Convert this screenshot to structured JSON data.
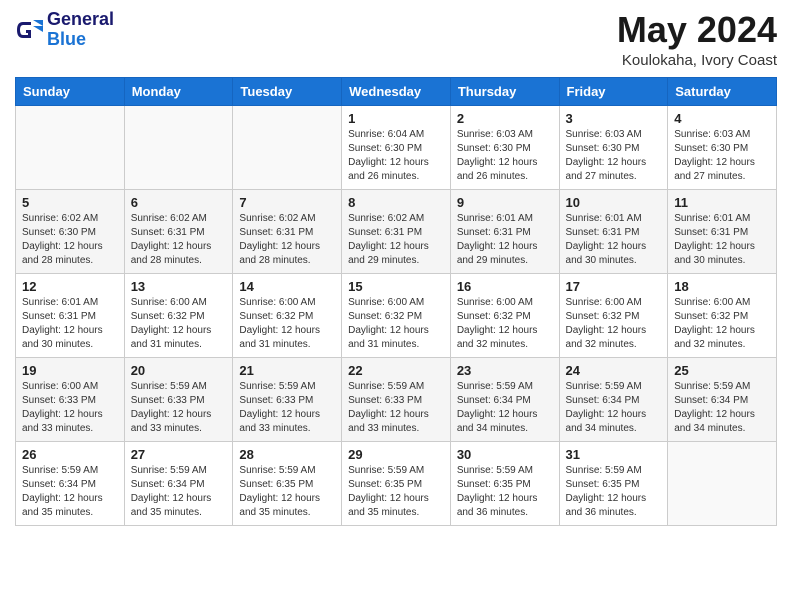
{
  "header": {
    "logo_line1": "General",
    "logo_line2": "Blue",
    "title": "May 2024",
    "location": "Koulokaha, Ivory Coast"
  },
  "weekdays": [
    "Sunday",
    "Monday",
    "Tuesday",
    "Wednesday",
    "Thursday",
    "Friday",
    "Saturday"
  ],
  "weeks": [
    [
      {
        "day": "",
        "info": ""
      },
      {
        "day": "",
        "info": ""
      },
      {
        "day": "",
        "info": ""
      },
      {
        "day": "1",
        "info": "Sunrise: 6:04 AM\nSunset: 6:30 PM\nDaylight: 12 hours\nand 26 minutes."
      },
      {
        "day": "2",
        "info": "Sunrise: 6:03 AM\nSunset: 6:30 PM\nDaylight: 12 hours\nand 26 minutes."
      },
      {
        "day": "3",
        "info": "Sunrise: 6:03 AM\nSunset: 6:30 PM\nDaylight: 12 hours\nand 27 minutes."
      },
      {
        "day": "4",
        "info": "Sunrise: 6:03 AM\nSunset: 6:30 PM\nDaylight: 12 hours\nand 27 minutes."
      }
    ],
    [
      {
        "day": "5",
        "info": "Sunrise: 6:02 AM\nSunset: 6:30 PM\nDaylight: 12 hours\nand 28 minutes."
      },
      {
        "day": "6",
        "info": "Sunrise: 6:02 AM\nSunset: 6:31 PM\nDaylight: 12 hours\nand 28 minutes."
      },
      {
        "day": "7",
        "info": "Sunrise: 6:02 AM\nSunset: 6:31 PM\nDaylight: 12 hours\nand 28 minutes."
      },
      {
        "day": "8",
        "info": "Sunrise: 6:02 AM\nSunset: 6:31 PM\nDaylight: 12 hours\nand 29 minutes."
      },
      {
        "day": "9",
        "info": "Sunrise: 6:01 AM\nSunset: 6:31 PM\nDaylight: 12 hours\nand 29 minutes."
      },
      {
        "day": "10",
        "info": "Sunrise: 6:01 AM\nSunset: 6:31 PM\nDaylight: 12 hours\nand 30 minutes."
      },
      {
        "day": "11",
        "info": "Sunrise: 6:01 AM\nSunset: 6:31 PM\nDaylight: 12 hours\nand 30 minutes."
      }
    ],
    [
      {
        "day": "12",
        "info": "Sunrise: 6:01 AM\nSunset: 6:31 PM\nDaylight: 12 hours\nand 30 minutes."
      },
      {
        "day": "13",
        "info": "Sunrise: 6:00 AM\nSunset: 6:32 PM\nDaylight: 12 hours\nand 31 minutes."
      },
      {
        "day": "14",
        "info": "Sunrise: 6:00 AM\nSunset: 6:32 PM\nDaylight: 12 hours\nand 31 minutes."
      },
      {
        "day": "15",
        "info": "Sunrise: 6:00 AM\nSunset: 6:32 PM\nDaylight: 12 hours\nand 31 minutes."
      },
      {
        "day": "16",
        "info": "Sunrise: 6:00 AM\nSunset: 6:32 PM\nDaylight: 12 hours\nand 32 minutes."
      },
      {
        "day": "17",
        "info": "Sunrise: 6:00 AM\nSunset: 6:32 PM\nDaylight: 12 hours\nand 32 minutes."
      },
      {
        "day": "18",
        "info": "Sunrise: 6:00 AM\nSunset: 6:32 PM\nDaylight: 12 hours\nand 32 minutes."
      }
    ],
    [
      {
        "day": "19",
        "info": "Sunrise: 6:00 AM\nSunset: 6:33 PM\nDaylight: 12 hours\nand 33 minutes."
      },
      {
        "day": "20",
        "info": "Sunrise: 5:59 AM\nSunset: 6:33 PM\nDaylight: 12 hours\nand 33 minutes."
      },
      {
        "day": "21",
        "info": "Sunrise: 5:59 AM\nSunset: 6:33 PM\nDaylight: 12 hours\nand 33 minutes."
      },
      {
        "day": "22",
        "info": "Sunrise: 5:59 AM\nSunset: 6:33 PM\nDaylight: 12 hours\nand 33 minutes."
      },
      {
        "day": "23",
        "info": "Sunrise: 5:59 AM\nSunset: 6:34 PM\nDaylight: 12 hours\nand 34 minutes."
      },
      {
        "day": "24",
        "info": "Sunrise: 5:59 AM\nSunset: 6:34 PM\nDaylight: 12 hours\nand 34 minutes."
      },
      {
        "day": "25",
        "info": "Sunrise: 5:59 AM\nSunset: 6:34 PM\nDaylight: 12 hours\nand 34 minutes."
      }
    ],
    [
      {
        "day": "26",
        "info": "Sunrise: 5:59 AM\nSunset: 6:34 PM\nDaylight: 12 hours\nand 35 minutes."
      },
      {
        "day": "27",
        "info": "Sunrise: 5:59 AM\nSunset: 6:34 PM\nDaylight: 12 hours\nand 35 minutes."
      },
      {
        "day": "28",
        "info": "Sunrise: 5:59 AM\nSunset: 6:35 PM\nDaylight: 12 hours\nand 35 minutes."
      },
      {
        "day": "29",
        "info": "Sunrise: 5:59 AM\nSunset: 6:35 PM\nDaylight: 12 hours\nand 35 minutes."
      },
      {
        "day": "30",
        "info": "Sunrise: 5:59 AM\nSunset: 6:35 PM\nDaylight: 12 hours\nand 36 minutes."
      },
      {
        "day": "31",
        "info": "Sunrise: 5:59 AM\nSunset: 6:35 PM\nDaylight: 12 hours\nand 36 minutes."
      },
      {
        "day": "",
        "info": ""
      }
    ]
  ]
}
